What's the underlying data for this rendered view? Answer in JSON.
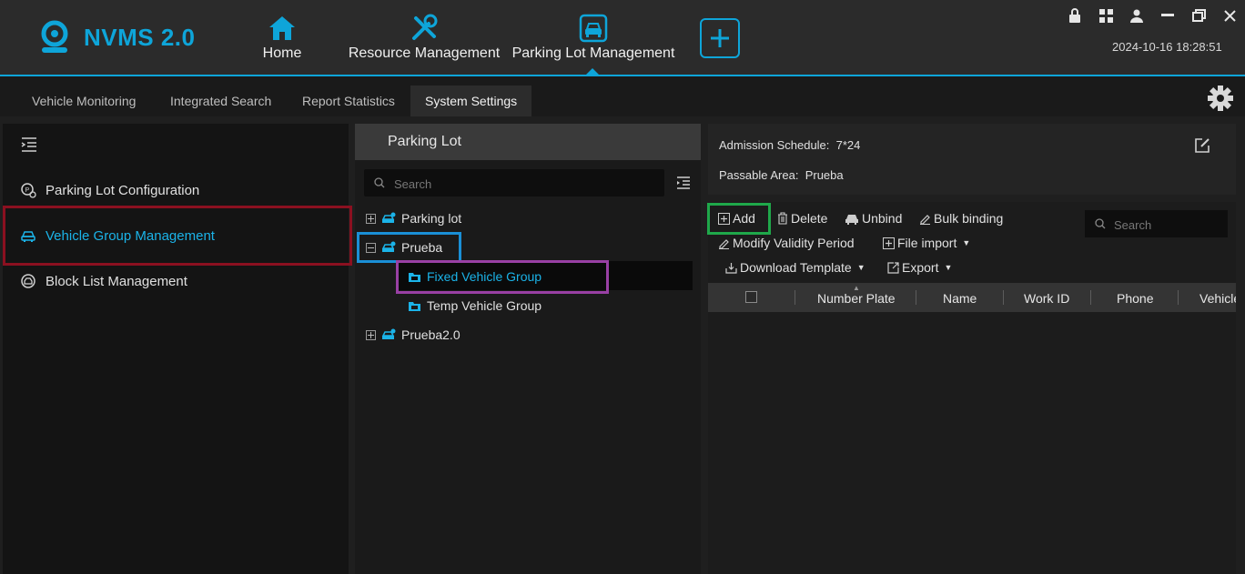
{
  "app": {
    "title": "NVMS 2.0",
    "datetime": "2024-10-16 18:28:51",
    "accent": "#0ea5d9"
  },
  "modules": [
    {
      "label": "Home",
      "icon": "home-icon"
    },
    {
      "label": "Resource Management",
      "icon": "tools-icon"
    },
    {
      "label": "Parking Lot Management",
      "icon": "car-icon",
      "active": true
    }
  ],
  "window_icons": [
    "lock-icon",
    "grid-icon",
    "user-icon",
    "minimize-icon",
    "restore-icon",
    "close-icon"
  ],
  "tabs": [
    {
      "label": "Vehicle Monitoring"
    },
    {
      "label": "Integrated Search"
    },
    {
      "label": "Report Statistics"
    },
    {
      "label": "System Settings",
      "active": true
    }
  ],
  "sidebar": {
    "items": [
      {
        "label": "Parking Lot Configuration",
        "icon": "parking-config-icon"
      },
      {
        "label": "Vehicle Group Management",
        "icon": "car-group-icon",
        "active": true
      },
      {
        "label": "Block List Management",
        "icon": "block-list-icon"
      }
    ]
  },
  "tree": {
    "title": "Parking Lot",
    "search_placeholder": "Search",
    "nodes": [
      {
        "label": "Parking lot",
        "expanded": false
      },
      {
        "label": "Prueba",
        "expanded": true,
        "children": [
          {
            "label": "Fixed Vehicle Group",
            "selected": true
          },
          {
            "label": "Temp Vehicle Group"
          }
        ]
      },
      {
        "label": "Prueba2.0",
        "expanded": false
      }
    ]
  },
  "info": {
    "schedule_label": "Admission Schedule:",
    "schedule_value": "7*24",
    "area_label": "Passable Area:",
    "area_value": "Prueba"
  },
  "toolbar": {
    "add": "Add",
    "delete": "Delete",
    "unbind": "Unbind",
    "bulk": "Bulk binding",
    "modify": "Modify Validity Period",
    "import": "File import",
    "template": "Download Template",
    "export": "Export",
    "search_placeholder": "Search"
  },
  "table": {
    "columns": [
      "Number Plate",
      "Name",
      "Work ID",
      "Phone",
      "Vehicle"
    ]
  },
  "highlights": {
    "red": "#8b1020",
    "blue": "#1a8fd6",
    "purple": "#9940a4",
    "green": "#1fa84a"
  }
}
